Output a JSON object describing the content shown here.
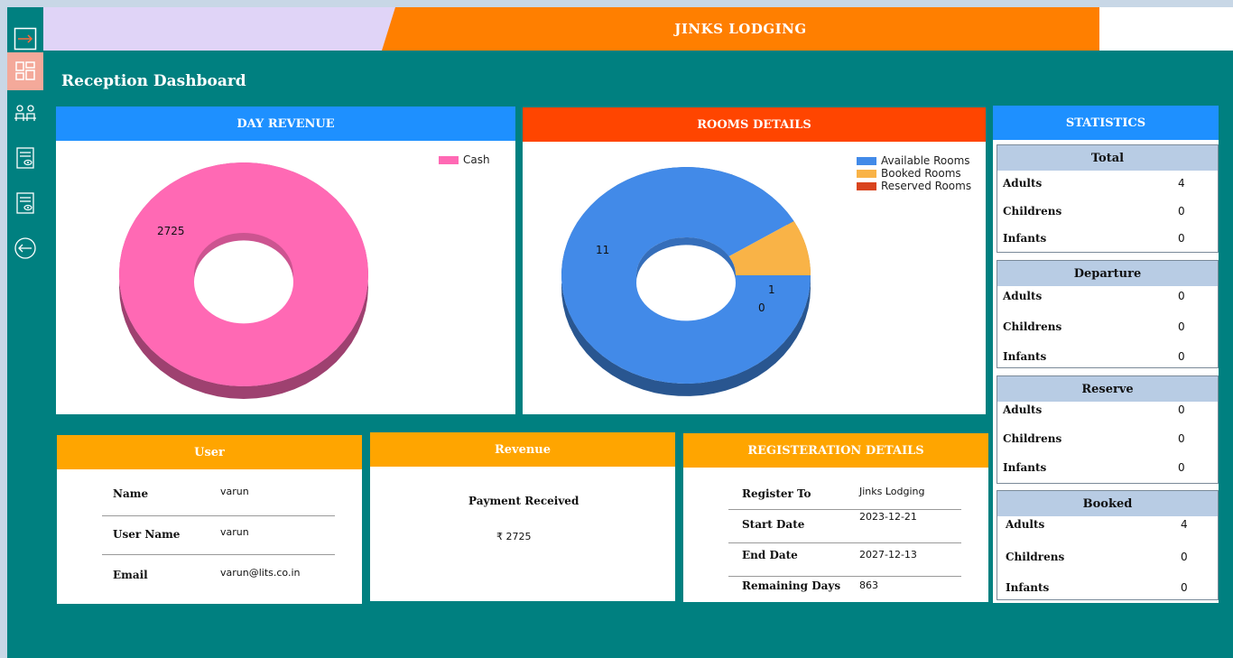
{
  "app": {
    "title": "JINKS LODGING",
    "page_title": "Reception Dashboard"
  },
  "sidebar": {
    "items": [
      {
        "name": "login-arrow-icon"
      },
      {
        "name": "dashboard-grid-icon"
      },
      {
        "name": "reception-people-icon"
      },
      {
        "name": "invoice-view-icon"
      },
      {
        "name": "report-view-icon"
      },
      {
        "name": "logout-arrow-icon"
      }
    ]
  },
  "colors": {
    "teal": "#008080",
    "orange": "#ff7f00",
    "blue_header": "#1e90ff",
    "red_header": "#ff4500",
    "amber_header": "#ffa500"
  },
  "day_revenue": {
    "title": "DAY REVENUE",
    "chart_data": {
      "type": "pie",
      "categories": [
        "Cash"
      ],
      "values": [
        2725
      ],
      "colors": [
        "#ff69b4"
      ],
      "legend": "top-right",
      "data_labels": [
        "2725"
      ]
    }
  },
  "rooms_details": {
    "title": "ROOMS DETAILS",
    "chart_data": {
      "type": "pie",
      "categories": [
        "Available Rooms",
        "Booked Rooms",
        "Reserved Rooms"
      ],
      "values": [
        11,
        1,
        0
      ],
      "colors": [
        "#428ae8",
        "#f9b347",
        "#d9441e"
      ],
      "legend": "top-right",
      "data_labels": [
        "11",
        "1",
        "0"
      ]
    }
  },
  "statistics": {
    "title": "STATISTICS",
    "groups": [
      {
        "title": "Total",
        "rows": [
          {
            "label": "Adults",
            "value": "4"
          },
          {
            "label": "Childrens",
            "value": "0"
          },
          {
            "label": "Infants",
            "value": "0"
          }
        ]
      },
      {
        "title": "Departure",
        "rows": [
          {
            "label": "Adults",
            "value": "0"
          },
          {
            "label": "Childrens",
            "value": "0"
          },
          {
            "label": "Infants",
            "value": "0"
          }
        ]
      },
      {
        "title": "Reserve",
        "rows": [
          {
            "label": "Adults",
            "value": "0"
          },
          {
            "label": "Childrens",
            "value": "0"
          },
          {
            "label": "Infants",
            "value": "0"
          }
        ]
      },
      {
        "title": "Booked",
        "rows": [
          {
            "label": "Adults",
            "value": "4"
          },
          {
            "label": "Childrens",
            "value": "0"
          },
          {
            "label": "Infants",
            "value": "0"
          }
        ]
      }
    ]
  },
  "user": {
    "title": "User",
    "name_label": "Name",
    "name": "varun",
    "username_label": "User Name",
    "username": "varun",
    "email_label": "Email",
    "email": "varun@lits.co.in"
  },
  "revenue": {
    "title": "Revenue",
    "payment_label": "Payment Received",
    "payment_value": "₹ 2725"
  },
  "registration": {
    "title": "REGISTERATION DETAILS",
    "rows": [
      {
        "label": "Register To",
        "value": "Jinks Lodging"
      },
      {
        "label": "Start Date",
        "value": "2023-12-21"
      },
      {
        "label": "End Date",
        "value": "2027-12-13"
      },
      {
        "label": "Remaining Days",
        "value": "863"
      }
    ]
  }
}
